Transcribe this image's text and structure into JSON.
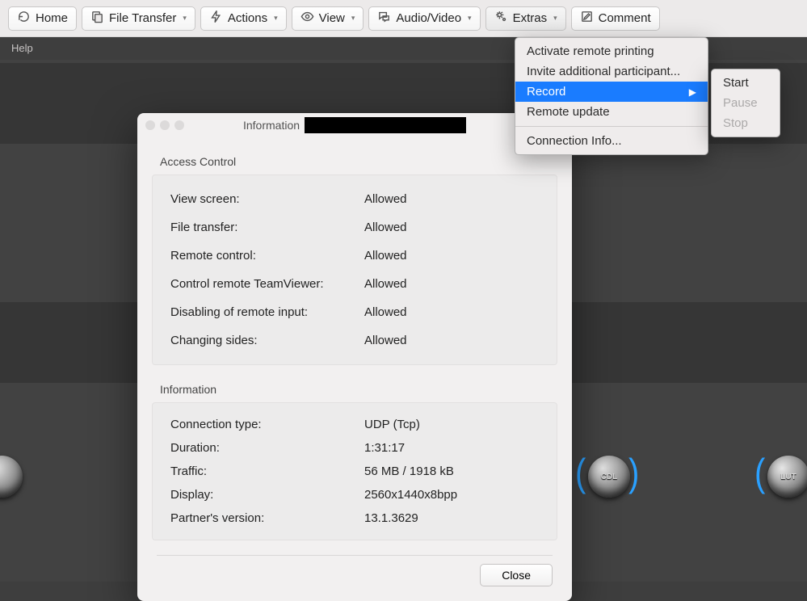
{
  "toolbar": {
    "home": "Home",
    "file": "File Transfer",
    "actions": "Actions",
    "view": "View",
    "av": "Audio/Video",
    "extras": "Extras",
    "comment": "Comment"
  },
  "helpbar": {
    "text": "Help"
  },
  "extras_menu": {
    "activate_printing": "Activate remote printing",
    "invite": "Invite additional participant...",
    "record": "Record",
    "remote_update": "Remote update",
    "connection_info": "Connection Info..."
  },
  "record_menu": {
    "start": "Start",
    "pause": "Pause",
    "stop": "Stop"
  },
  "dialog": {
    "title_prefix": "Information",
    "access_section": "Access Control",
    "access": [
      {
        "k": "View screen:",
        "v": "Allowed"
      },
      {
        "k": "File transfer:",
        "v": "Allowed"
      },
      {
        "k": "Remote control:",
        "v": "Allowed"
      },
      {
        "k": "Control remote TeamViewer:",
        "v": "Allowed"
      },
      {
        "k": "Disabling of remote input:",
        "v": "Allowed"
      },
      {
        "k": "Changing sides:",
        "v": "Allowed"
      }
    ],
    "info_section": "Information",
    "info": [
      {
        "k": "Connection type:",
        "v": "UDP (Tcp)"
      },
      {
        "k": "Duration:",
        "v": "1:31:17"
      },
      {
        "k": "Traffic:",
        "v": "56 MB / 1918 kB"
      },
      {
        "k": "Display:",
        "v": "2560x1440x8bpp"
      },
      {
        "k": "Partner's version:",
        "v": "13.1.3629"
      }
    ],
    "close": "Close"
  },
  "bg_nodes": {
    "cdl": "CDL",
    "lut": "LUT"
  }
}
